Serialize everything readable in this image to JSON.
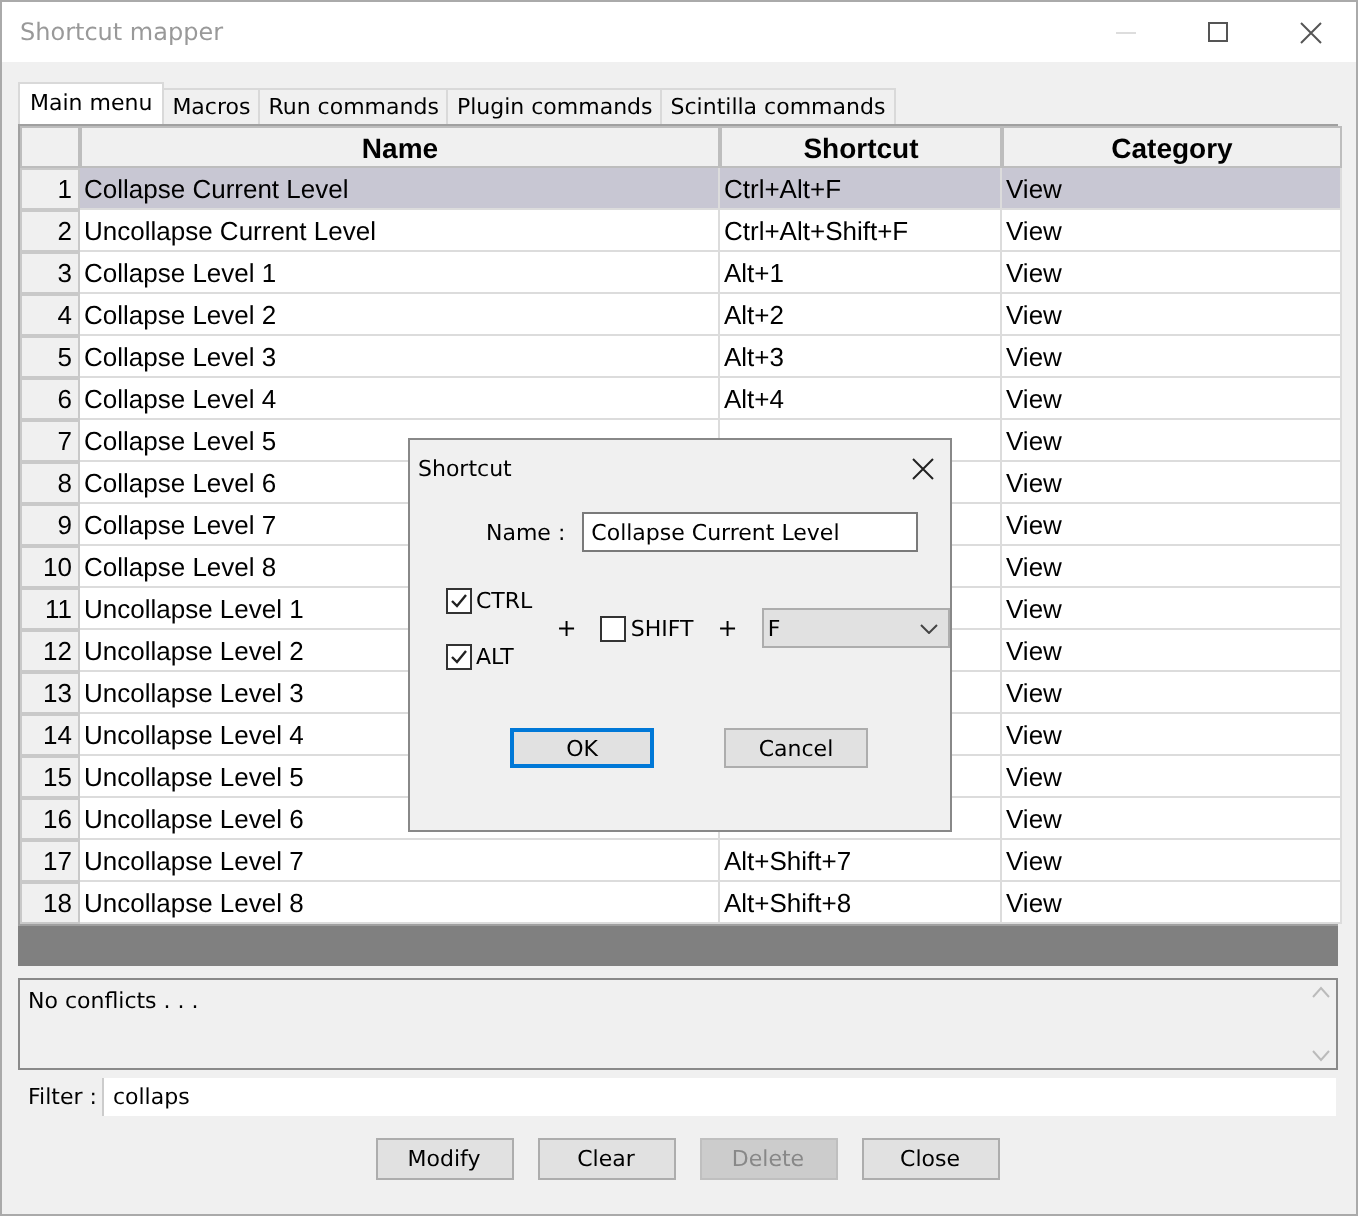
{
  "window": {
    "title": "Shortcut mapper"
  },
  "tabs": [
    {
      "label": "Main menu",
      "selected": true
    },
    {
      "label": "Macros",
      "selected": false
    },
    {
      "label": "Run commands",
      "selected": false
    },
    {
      "label": "Plugin commands",
      "selected": false
    },
    {
      "label": "Scintilla commands",
      "selected": false
    }
  ],
  "table": {
    "columns": [
      "Name",
      "Shortcut",
      "Category"
    ],
    "rows": [
      {
        "number": "1",
        "name": "Collapse Current Level",
        "shortcut": "Ctrl+Alt+F",
        "category": "View",
        "selected": true
      },
      {
        "number": "2",
        "name": "Uncollapse Current Level",
        "shortcut": "Ctrl+Alt+Shift+F",
        "category": "View",
        "selected": false
      },
      {
        "number": "3",
        "name": "Collapse Level 1",
        "shortcut": "Alt+1",
        "category": "View",
        "selected": false
      },
      {
        "number": "4",
        "name": "Collapse Level 2",
        "shortcut": "Alt+2",
        "category": "View",
        "selected": false
      },
      {
        "number": "5",
        "name": "Collapse Level 3",
        "shortcut": "Alt+3",
        "category": "View",
        "selected": false
      },
      {
        "number": "6",
        "name": "Collapse Level 4",
        "shortcut": "Alt+4",
        "category": "View",
        "selected": false
      },
      {
        "number": "7",
        "name": "Collapse Level 5",
        "category": "View",
        "selected": false
      },
      {
        "number": "8",
        "name": "Collapse Level 6",
        "category": "View",
        "selected": false
      },
      {
        "number": "9",
        "name": "Collapse Level 7",
        "category": "View",
        "selected": false
      },
      {
        "number": "10",
        "name": "Collapse Level 8",
        "category": "View",
        "selected": false
      },
      {
        "number": "11",
        "name": "Uncollapse Level 1",
        "category": "View",
        "selected": false
      },
      {
        "number": "12",
        "name": "Uncollapse Level 2",
        "category": "View",
        "selected": false
      },
      {
        "number": "13",
        "name": "Uncollapse Level 3",
        "category": "View",
        "selected": false
      },
      {
        "number": "14",
        "name": "Uncollapse Level 4",
        "category": "View",
        "selected": false
      },
      {
        "number": "15",
        "name": "Uncollapse Level 5",
        "category": "View",
        "selected": false
      },
      {
        "number": "16",
        "name": "Uncollapse Level 6",
        "category": "View",
        "selected": false
      },
      {
        "number": "17",
        "name": "Uncollapse Level 7",
        "shortcut": "Alt+Shift+7",
        "category": "View",
        "selected": false
      },
      {
        "number": "18",
        "name": "Uncollapse Level 8",
        "shortcut": "Alt+Shift+8",
        "category": "View",
        "selected": false
      }
    ]
  },
  "conflicts": {
    "text": "No conflicts . . ."
  },
  "filter": {
    "label": "Filter :",
    "value": "collaps"
  },
  "buttons": [
    {
      "label": "Modify",
      "disabled": false
    },
    {
      "label": "Clear",
      "disabled": false
    },
    {
      "label": "Delete",
      "disabled": true
    },
    {
      "label": "Close",
      "disabled": false
    }
  ],
  "dialog": {
    "title": "Shortcut",
    "name_label": "Name :",
    "name_value": "Collapse Current Level",
    "ctrl": {
      "label": "CTRL",
      "checked": true
    },
    "alt": {
      "label": "ALT",
      "checked": true
    },
    "shift": {
      "label": "SHIFT",
      "checked": false
    },
    "plus_1": "+",
    "plus_2": "+",
    "key": "F",
    "buttons": [
      {
        "label": "OK",
        "default": true
      },
      {
        "label": "Cancel",
        "default": false
      }
    ]
  }
}
